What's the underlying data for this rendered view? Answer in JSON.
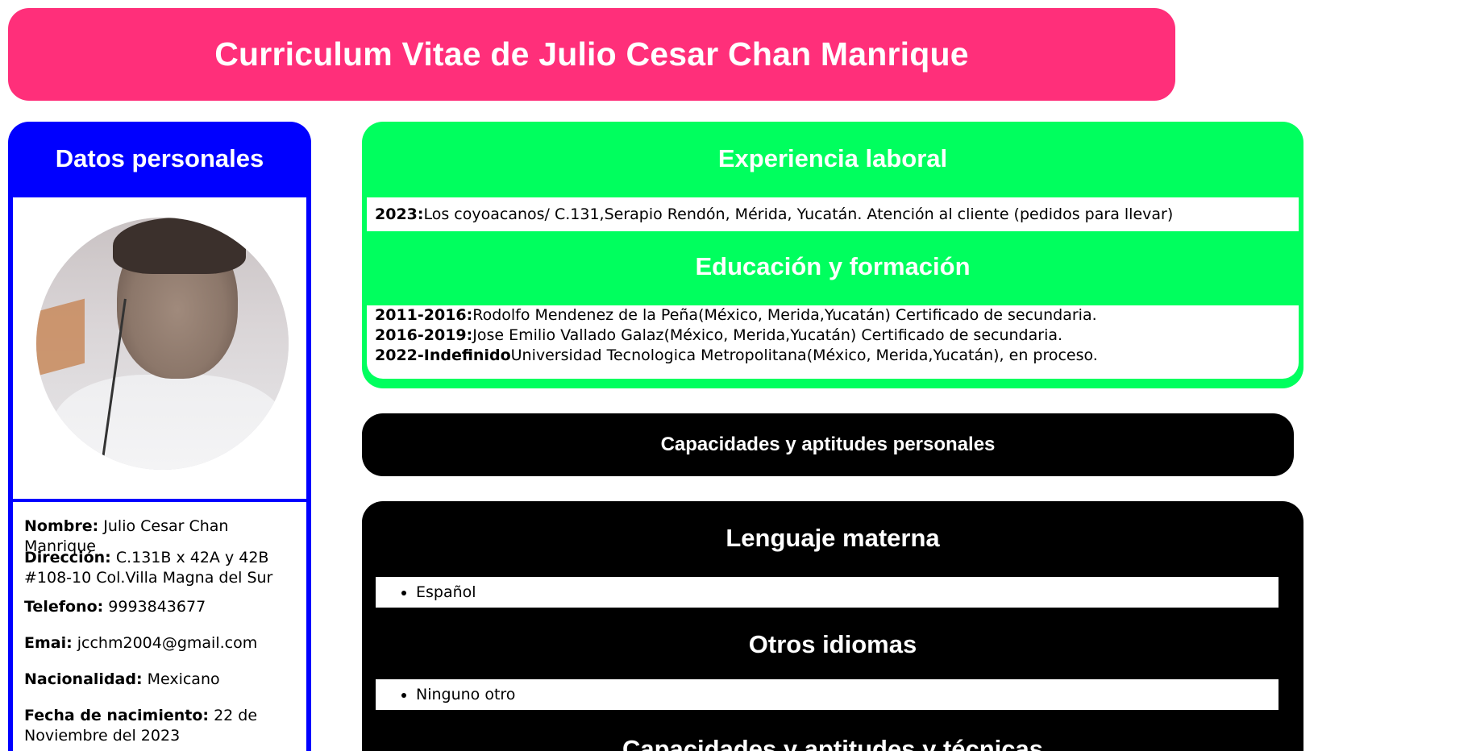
{
  "header": {
    "title": "Curriculum Vitae de Julio Cesar Chan Manrique"
  },
  "personal": {
    "heading": "Datos personales",
    "fields": [
      {
        "label": "Nombre:",
        "value": "Julio Cesar Chan Manrique"
      },
      {
        "label": "Dirección:",
        "value": "C.131B x 42A y 42B #108-10 Col.Villa Magna del Sur"
      },
      {
        "label": "Telefono:",
        "value": "9993843677"
      },
      {
        "label": "Emai:",
        "value": "jcchm2004@gmail.com"
      },
      {
        "label": "Nacionalidad:",
        "value": "Mexicano"
      },
      {
        "label": "Fecha de nacimiento:",
        "value": "22 de Noviembre del 2023"
      }
    ]
  },
  "experience": {
    "heading": "Experiencia laboral",
    "items": [
      {
        "year": "2023:",
        "text": "Los coyoacanos/ C.131,Serapio Rendón, Mérida, Yucatán. Atención al cliente (pedidos para llevar)"
      }
    ]
  },
  "education": {
    "heading": "Educación y formación",
    "items": [
      {
        "period": "2011-2016:",
        "text": "Rodolfo Mendenez de la Peña(México, Merida,Yucatán) Certificado de secundaria."
      },
      {
        "period": "2016-2019:",
        "text": "Jose Emilio Vallado Galaz(México, Merida,Yucatán) Certificado de secundaria."
      },
      {
        "period": "2022-Indefinido",
        "text": "Universidad Tecnologica Metropolitana(México, Merida,Yucatán), en proceso."
      }
    ]
  },
  "capabilities": {
    "banner": "Capacidades y aptitudes personales"
  },
  "languages": {
    "mother_heading": "Lenguaje materna",
    "mother_items": [
      "Español"
    ],
    "other_heading": "Otros idiomas",
    "other_items": [
      "Ninguno otro"
    ],
    "tech_heading": "Capacidades y aptitudes y técnicas"
  },
  "colors": {
    "title_bg": "#ff2f7a",
    "personal_bg": "#0000ff",
    "experience_bg": "#00ff5e",
    "capabilities_bg": "#000000"
  }
}
